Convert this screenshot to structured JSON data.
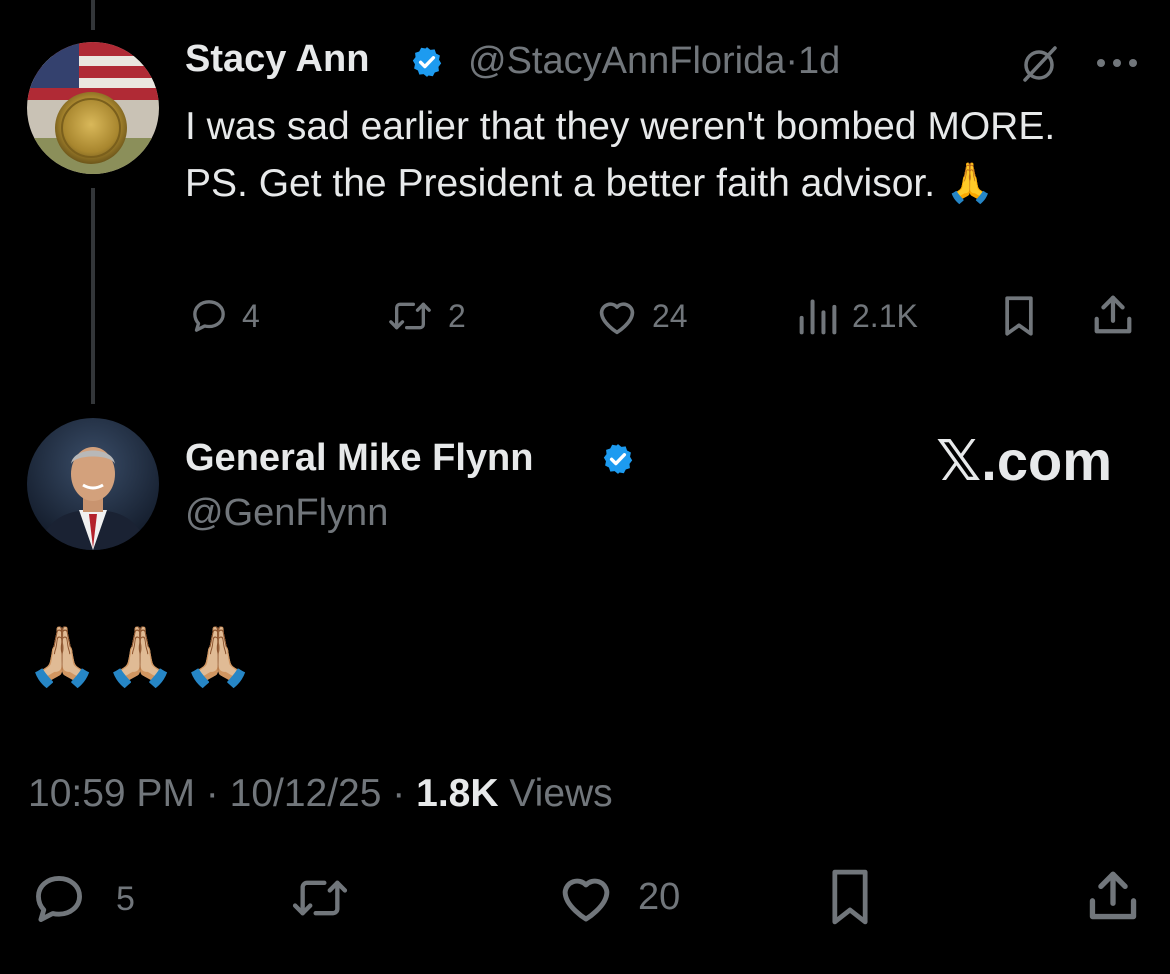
{
  "colors": {
    "background": "#000000",
    "text_primary": "#e7e9ea",
    "text_secondary": "#71767b",
    "verified_blue": "#1d9bf0",
    "thread_line": "#333639"
  },
  "parent_tweet": {
    "author_name": "Stacy Ann",
    "verified_icon": "verified-badge-icon",
    "handle": "@StacyAnnFlorida",
    "separator": "·",
    "age": "1d",
    "text": "I was sad earlier that they weren't bombed MORE. PS. Get the President a better faith advisor. 🙏",
    "actions": {
      "replies": "4",
      "reposts": "2",
      "likes": "24",
      "views": "2.1K"
    }
  },
  "main_tweet": {
    "author_name": "General Mike Flynn",
    "verified_icon": "verified-badge-icon",
    "handle": "@GenFlynn",
    "text": "🙏🏼🙏🏼🙏🏼",
    "time": "10:59 PM",
    "sep1": "·",
    "date": "10/12/25",
    "sep2": "·",
    "views_count": "1.8K",
    "views_label": "Views",
    "actions": {
      "replies": "5",
      "likes": "20"
    }
  },
  "watermark": "𝕏.com"
}
